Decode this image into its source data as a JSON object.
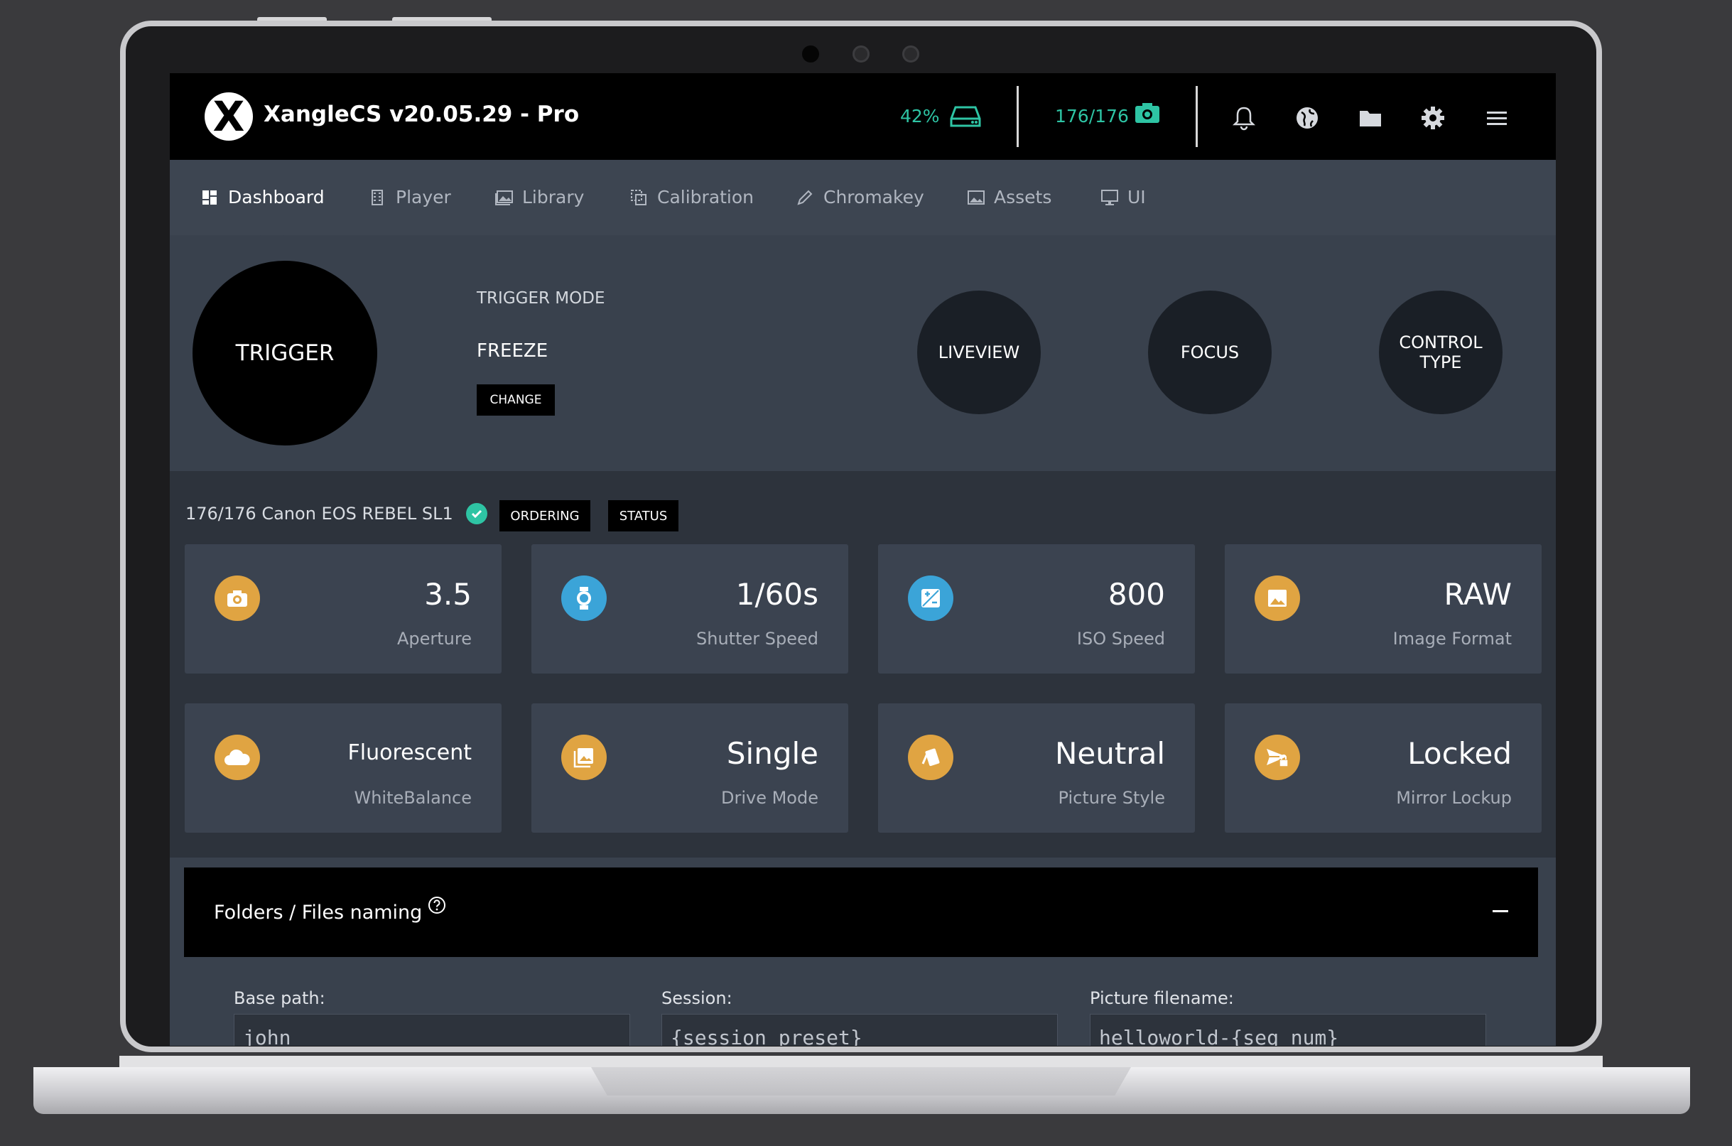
{
  "app": {
    "title": "XangleCS v20.05.29 - Pro",
    "logo_letter": "X"
  },
  "topbar": {
    "storage_percent": "42%",
    "camera_count": "176/176",
    "right_icons": [
      "bell-icon",
      "globe-icon",
      "folder-icon",
      "gear-icon",
      "menu-icon"
    ],
    "accent_color": "#2ec4a4"
  },
  "nav": {
    "items": [
      {
        "label": "Dashboard",
        "icon": "dashboard-icon",
        "active": true
      },
      {
        "label": "Player",
        "icon": "film-icon"
      },
      {
        "label": "Library",
        "icon": "image-icon"
      },
      {
        "label": "Calibration",
        "icon": "calibration-icon"
      },
      {
        "label": "Chromakey",
        "icon": "pen-icon"
      },
      {
        "label": "Assets",
        "icon": "picture-icon"
      },
      {
        "label": "UI",
        "icon": "monitor-icon"
      }
    ]
  },
  "trigger": {
    "button_label": "TRIGGER",
    "mode_label": "TRIGGER MODE",
    "mode_value": "FREEZE",
    "change_label": "CHANGE",
    "liveview_label": "LIVEVIEW",
    "focus_label": "FOCUS",
    "control_type_label": "CONTROL TYPE"
  },
  "cameras": {
    "summary": "176/176 Canon EOS REBEL SL1",
    "ordering_label": "ORDERING",
    "status_label": "STATUS"
  },
  "settings_cards": [
    {
      "value": "3.5",
      "label": "Aperture",
      "icon": "camera-icon",
      "color": "#e0a442"
    },
    {
      "value": "1/60s",
      "label": "Shutter Speed",
      "icon": "watch-icon",
      "color": "#3ba4d8"
    },
    {
      "value": "800",
      "label": "ISO Speed",
      "icon": "exposure-icon",
      "color": "#3ba4d8"
    },
    {
      "value": "RAW",
      "label": "Image Format",
      "icon": "image-icon",
      "color": "#e0a442"
    },
    {
      "value": "Fluorescent",
      "label": "WhiteBalance",
      "icon": "cloud-icon",
      "color": "#e0a442"
    },
    {
      "value": "Single",
      "label": "Drive Mode",
      "icon": "image-stack-icon",
      "color": "#e0a442"
    },
    {
      "value": "Neutral",
      "label": "Picture Style",
      "icon": "cards-icon",
      "color": "#e0a442"
    },
    {
      "value": "Locked",
      "label": "Mirror Lockup",
      "icon": "send-lock-icon",
      "color": "#e0a442"
    }
  ],
  "folders": {
    "title": "Folders / Files naming",
    "base_path_label": "Base path:",
    "base_path_value": "john",
    "session_label": "Session:",
    "session_value": "{session_preset}",
    "filename_label": "Picture filename:",
    "filename_value": "helloworld-{seq_num}"
  }
}
